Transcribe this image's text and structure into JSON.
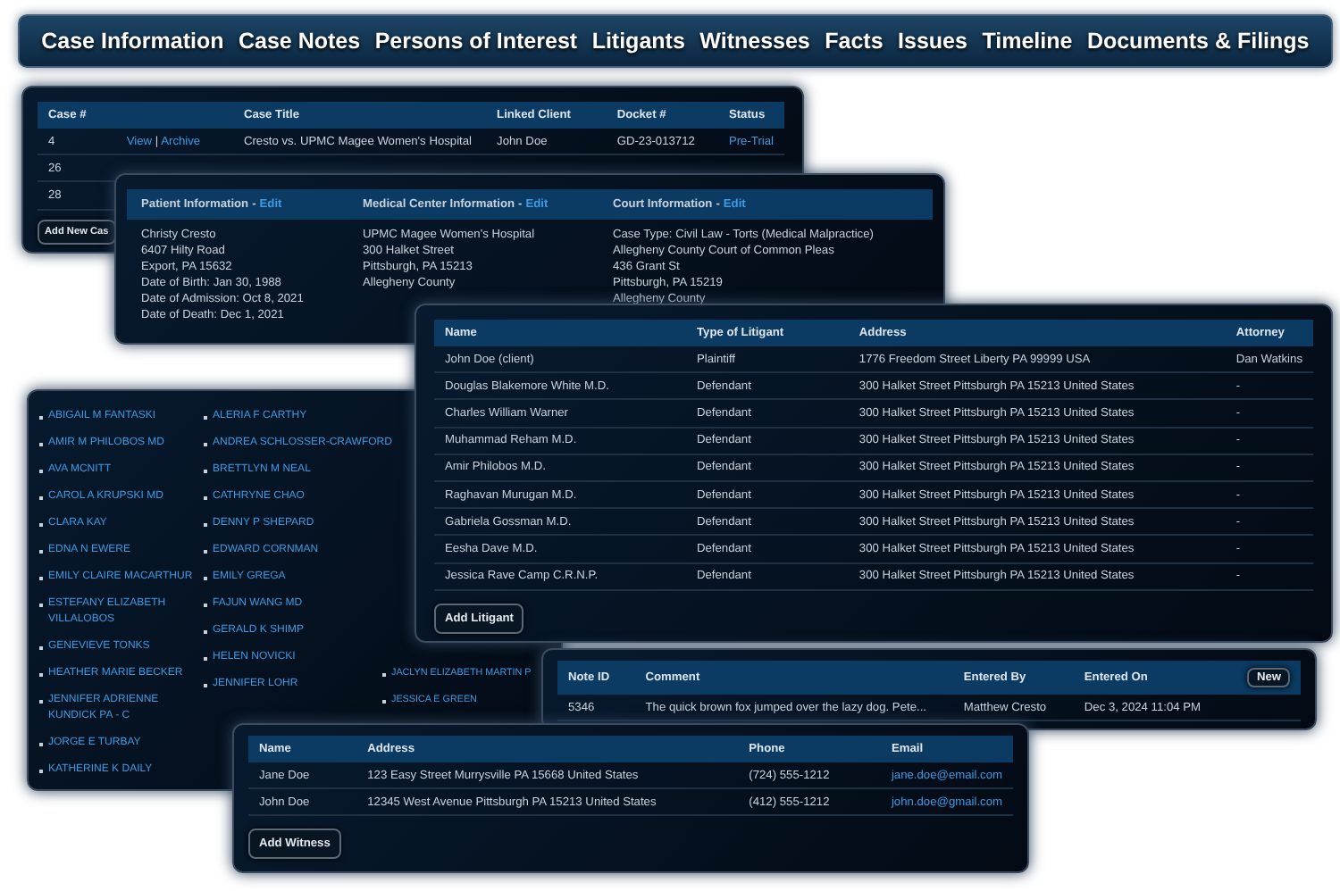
{
  "nav": {
    "tabs": [
      {
        "label": "Case Information"
      },
      {
        "label": "Case Notes"
      },
      {
        "label": "Persons of Interest"
      },
      {
        "label": "Litigants"
      },
      {
        "label": "Witnesses"
      },
      {
        "label": "Facts"
      },
      {
        "label": "Issues"
      },
      {
        "label": "Timeline"
      },
      {
        "label": "Documents & Filings"
      }
    ]
  },
  "cases": {
    "columns": [
      "Case #",
      "Case Title",
      "Linked Client",
      "Docket #",
      "Status"
    ],
    "rows": [
      {
        "case": "4",
        "view": "View",
        "separator": "|",
        "archive": "Archive",
        "title": "Cresto vs. UPMC Magee Women's Hospital",
        "client": "John Doe",
        "docket": "GD-23-013712",
        "status": "Pre-Trial"
      },
      {
        "case": "26"
      },
      {
        "case": "28"
      }
    ],
    "button": "Add New Cas"
  },
  "case_info": {
    "sections": [
      {
        "heading": "Patient Information",
        "separator": "-",
        "edit": "Edit",
        "lines": [
          "Christy Cresto",
          "6407 Hilty Road",
          "Export, PA 15632",
          "Date of Birth: Jan 30, 1988",
          "Date of Admission: Oct 8, 2021",
          "Date of Death: Dec 1, 2021"
        ]
      },
      {
        "heading": "Medical Center Information",
        "separator": "-",
        "edit": "Edit",
        "lines": [
          "UPMC Magee Women's Hospital",
          "300 Halket Street",
          "Pittsburgh, PA 15213",
          "Allegheny County"
        ]
      },
      {
        "heading": "Court Information",
        "separator": "-",
        "edit": "Edit",
        "lines": [
          "Case Type: Civil Law - Torts (Medical Malpractice)",
          "Allegheny County Court of Common Pleas",
          "436 Grant St",
          "Pittsburgh, PA 15219",
          "Allegheny County"
        ]
      }
    ]
  },
  "persons": {
    "columns": [
      [
        "ABIGAIL M FANTASKI",
        "AMIR M PHILOBOS MD",
        "AVA MCNITT",
        "CAROL A KRUPSKI MD",
        "CLARA KAY",
        "EDNA N EWERE",
        "EMILY CLAIRE MACARTHUR",
        "ESTEFANY ELIZABETH VILLALOBOS",
        "GENEVIEVE TONKS",
        "HEATHER MARIE BECKER",
        "JENNIFER ADRIENNE KUNDICK PA - C",
        "JORGE E TURBAY",
        "KATHERINE K DAILY"
      ],
      [
        "ALERIA F CARTHY",
        "ANDREA SCHLOSSER-CRAWFORD",
        "BRETTLYN M NEAL",
        "CATHRYNE CHAO",
        "DENNY P SHEPARD",
        "EDWARD CORNMAN",
        "EMILY GREGA",
        "FAJUN WANG MD",
        "GERALD K SHIMP",
        "HELEN NOVICKI",
        "JENNIFER LOHR"
      ],
      [
        "JACLYN ELIZABETH MARTIN P",
        "JESSICA E GREEN"
      ]
    ]
  },
  "litigants": {
    "columns": [
      "Name",
      "Type of Litigant",
      "Address",
      "Attorney"
    ],
    "rows": [
      [
        "John Doe (client)",
        "Plaintiff",
        "1776 Freedom Street Liberty PA 99999 USA",
        "Dan Watkins"
      ],
      [
        "Douglas Blakemore White M.D.",
        "Defendant",
        "300 Halket Street Pittsburgh PA 15213 United States",
        "-"
      ],
      [
        "Charles William Warner",
        "Defendant",
        "300 Halket Street Pittsburgh PA 15213 United States",
        "-"
      ],
      [
        "Muhammad Reham M.D.",
        "Defendant",
        "300 Halket Street Pittsburgh PA 15213 United States",
        "-"
      ],
      [
        "Amir Philobos M.D.",
        "Defendant",
        "300 Halket Street Pittsburgh PA 15213 United States",
        "-"
      ],
      [
        "Raghavan Murugan M.D.",
        "Defendant",
        "300 Halket Street Pittsburgh PA 15213 United States",
        "-"
      ],
      [
        "Gabriela Gossman M.D.",
        "Defendant",
        "300 Halket Street Pittsburgh PA 15213 United States",
        "-"
      ],
      [
        "Eesha Dave M.D.",
        "Defendant",
        "300 Halket Street Pittsburgh PA 15213 United States",
        "-"
      ],
      [
        "Jessica Rave Camp C.R.N.P.",
        "Defendant",
        "300 Halket Street Pittsburgh PA 15213 United States",
        "-"
      ]
    ],
    "button": "Add Litigant"
  },
  "notes": {
    "columns": [
      "Note ID",
      "Comment",
      "Entered By",
      "Entered On"
    ],
    "button": "New",
    "rows": [
      [
        "5346",
        "The quick brown fox jumped over the lazy dog. Pete...",
        "Matthew Cresto",
        "Dec 3, 2024 11:04 PM"
      ]
    ]
  },
  "witnesses": {
    "columns": [
      "Name",
      "Address",
      "Phone",
      "Email"
    ],
    "rows": [
      {
        "name": "Jane Doe",
        "address": "123 Easy Street Murrysville PA 15668 United States",
        "phone": "(724) 555-1212",
        "email": "jane.doe@email.com"
      },
      {
        "name": "John Doe",
        "address": "12345 West Avenue Pittsburgh PA 15213 United States",
        "phone": "(412) 555-1212",
        "email": "john.doe@gmail.com"
      }
    ],
    "button": "Add Witness"
  }
}
